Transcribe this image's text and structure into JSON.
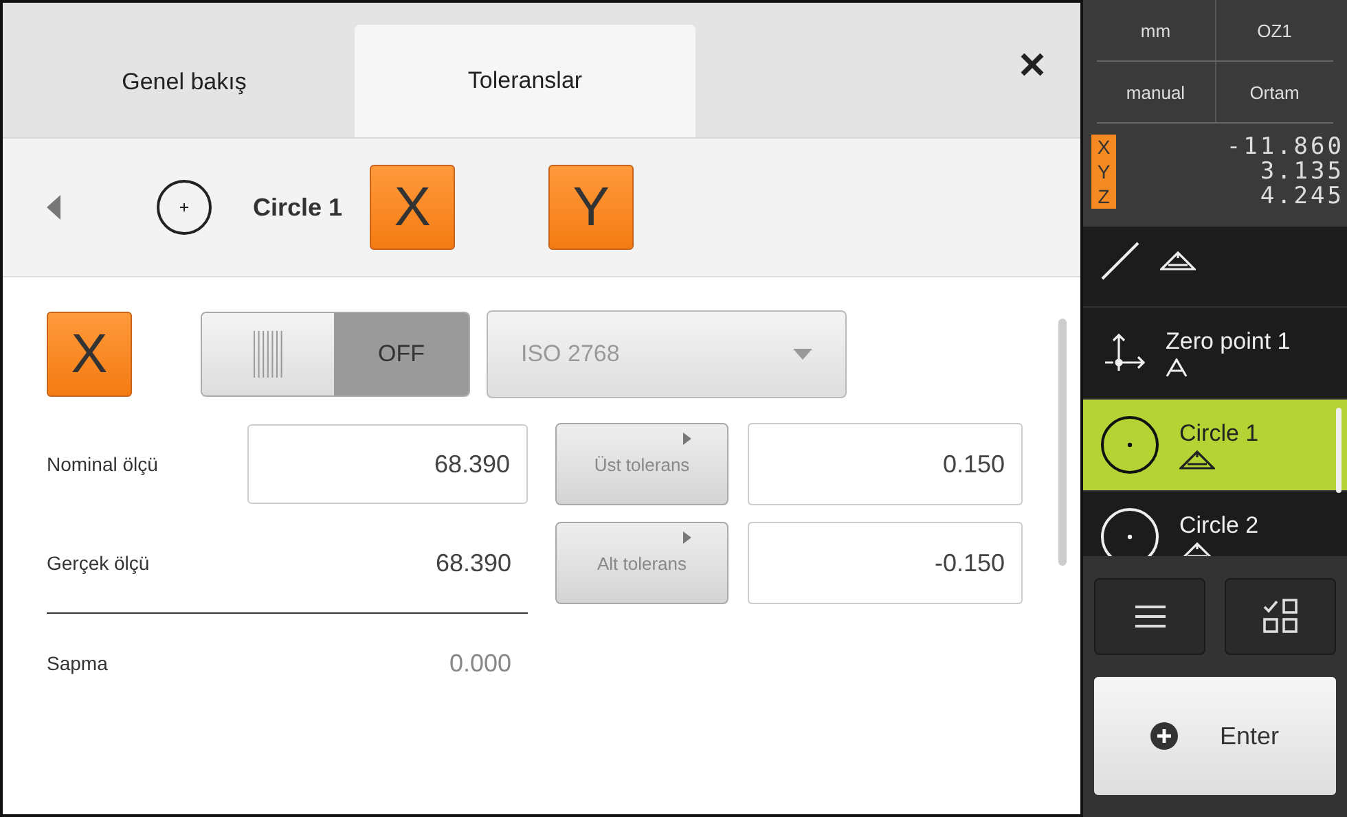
{
  "tabs": [
    {
      "label": "Genel bakış",
      "selected": false
    },
    {
      "label": "Toleranslar",
      "selected": true
    }
  ],
  "header": {
    "feature_name": "Circle 1",
    "axes": [
      "X",
      "Y"
    ]
  },
  "tolerance": {
    "axis": "X",
    "toggle": {
      "label": "OFF",
      "on": false
    },
    "standard": {
      "value": "ISO 2768",
      "disabled": true
    },
    "measures": [
      {
        "label": "Nominal ölçü",
        "value": "68.390",
        "kind": "field"
      },
      {
        "label": "Gerçek ölçü",
        "value": "68.390",
        "kind": "text"
      },
      {
        "label": "Sapma",
        "value": "0.000",
        "kind": "deviation"
      }
    ],
    "limits": [
      {
        "label": "Üst tolerans",
        "value": "0.150"
      },
      {
        "label": "Alt tolerans",
        "value": "-0.150"
      }
    ]
  },
  "status": [
    [
      "mm",
      "OZ1"
    ],
    [
      "manual",
      "Ortam"
    ]
  ],
  "positions": [
    {
      "axis": "X",
      "value": "-11.860"
    },
    {
      "axis": "Y",
      "value": "3.135"
    },
    {
      "axis": "Z",
      "value": "4.245"
    }
  ],
  "features": [
    {
      "kind": "line",
      "selected": false
    },
    {
      "name": "Zero point 1",
      "kind": "zero-point",
      "selected": false
    },
    {
      "name": "Circle 1",
      "kind": "circle",
      "selected": true
    },
    {
      "name": "Circle 2",
      "kind": "circle",
      "selected": false
    }
  ],
  "enter_button": "Enter"
}
